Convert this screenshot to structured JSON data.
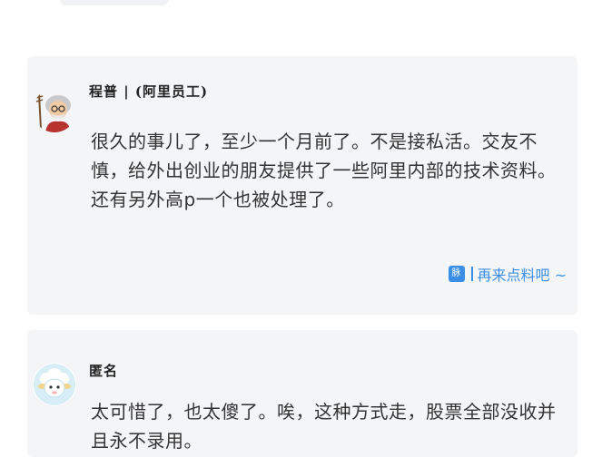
{
  "comments": [
    {
      "author": "程普 | (阿里员工)",
      "avatar_icon": "elderly-man-avatar-icon",
      "text": "很久的事儿了，至少一个月前了。不是接私活。交友不慎，给外出创业的朋友提供了一些阿里内部的技术资料。还有另外高p一个也被处理了。",
      "more": {
        "badge": "脉",
        "badge_icon": "maimai-badge-icon",
        "label": "再来点料吧 ~"
      }
    },
    {
      "author": "匿名",
      "avatar_icon": "sheep-avatar-icon",
      "text": "太可惜了，也太傻了。唉，这种方式走，股票全部没收并且永不录用。"
    }
  ],
  "colors": {
    "card_background": "#f4f5f7",
    "link_blue": "#3a8ee6",
    "text": "#333333"
  }
}
